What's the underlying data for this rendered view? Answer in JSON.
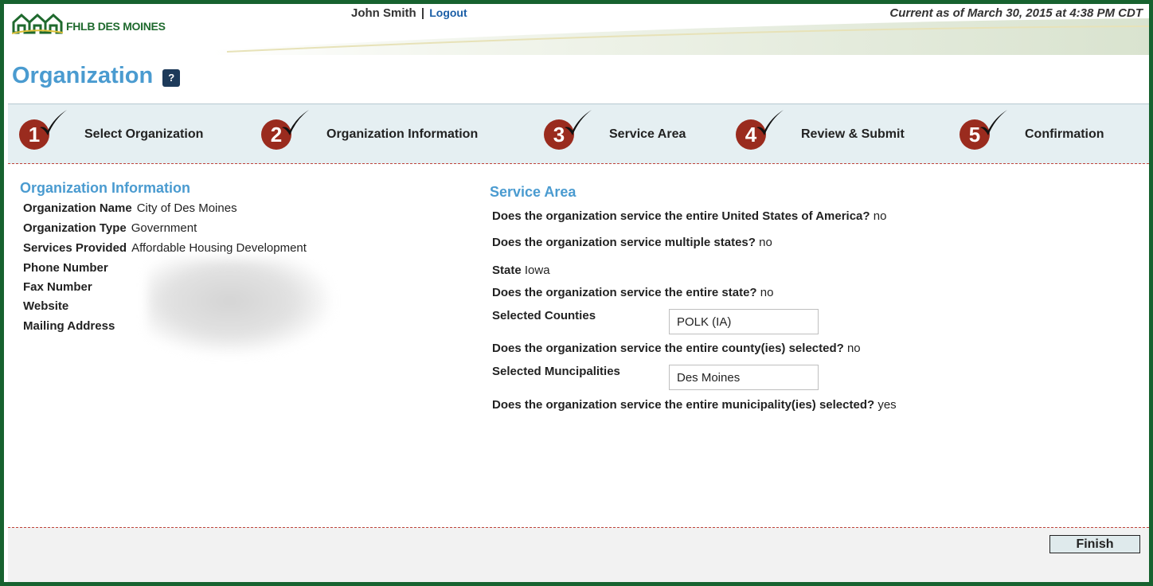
{
  "header": {
    "logo_text": "FHLB DES MOINES",
    "user_name": "John Smith",
    "separator": "|",
    "logout_label": "Logout",
    "current_as_of": "Current as of March 30, 2015 at 4:38 PM CDT"
  },
  "page": {
    "title": "Organization",
    "help_label": "?"
  },
  "steps": [
    {
      "number": "1",
      "label": "Select Organization"
    },
    {
      "number": "2",
      "label": "Organization Information"
    },
    {
      "number": "3",
      "label": "Service Area"
    },
    {
      "number": "4",
      "label": "Review & Submit"
    },
    {
      "number": "5",
      "label": "Confirmation"
    }
  ],
  "org_info": {
    "heading": "Organization Information",
    "fields": [
      {
        "label": "Organization Name",
        "value": "City of Des Moines"
      },
      {
        "label": "Organization Type",
        "value": "Government"
      },
      {
        "label": "Services Provided",
        "value": "Affordable Housing Development"
      },
      {
        "label": "Phone Number",
        "value": ""
      },
      {
        "label": "Fax Number",
        "value": ""
      },
      {
        "label": "Website",
        "value": ""
      },
      {
        "label": "Mailing Address",
        "value": ""
      }
    ]
  },
  "service_area": {
    "heading": "Service Area",
    "q_usa": "Does the organization service the entire United States of America?",
    "a_usa": "no",
    "q_multi_states": "Does the organization service multiple states?",
    "a_multi_states": "no",
    "state_label": "State",
    "state_value": "Iowa",
    "q_entire_state": "Does the organization service the entire state?",
    "a_entire_state": "no",
    "counties_label": "Selected Counties",
    "counties_value": "POLK (IA)",
    "q_entire_county": "Does the organization service the entire county(ies) selected?",
    "a_entire_county": "no",
    "municipalities_label": "Selected Muncipalities",
    "municipalities_value": "Des Moines",
    "q_entire_muni": "Does the organization service the entire municipality(ies) selected?",
    "a_entire_muni": "yes"
  },
  "footer": {
    "finish_label": "Finish"
  },
  "colors": {
    "frame": "#17622f",
    "title_blue": "#4a9bd0",
    "step_red": "#9a2b1e",
    "step_bar": "#e5eff2"
  }
}
